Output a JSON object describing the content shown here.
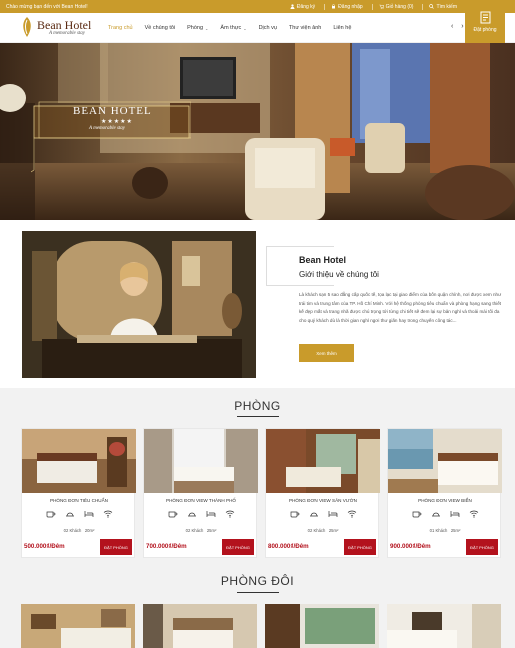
{
  "topbar": {
    "welcome": "Chào mừng bạn đến với Bean Hotel!",
    "register": "Đăng ký",
    "login": "Đăng nhập",
    "cart": "Giỏ hàng (0)",
    "search": "Tìm kiếm"
  },
  "logo": {
    "name": "Bean Hotel",
    "tagline": "A memorable stay"
  },
  "nav": {
    "home": "Trang chủ",
    "about": "Về chúng tôi",
    "rooms": "Phòng",
    "food": "Ẩm thực",
    "services": "Dịch vụ",
    "gallery": "Thư viện ảnh",
    "contact": "Liên hệ",
    "arrows": "‹ ›"
  },
  "book_button": "Đặt phòng",
  "hero": {
    "brand": "BEAN HOTEL",
    "stars": "★★★★★",
    "tagline": "A memorable stay"
  },
  "about": {
    "title": "Bean Hotel",
    "subtitle": "Giới thiệu về chúng tôi",
    "body": "Là khách sạn 5 sao đẳng cấp quốc tế, tọa lạc tại giao điểm của bốn quận chính, nơi được xem như trái tim và trung tâm của TP. Hồ Chí Minh. Với hệ thống phòng tiêu chuẩn và phòng hạng sang thiết kế đẹp mắt và trang nhã được chú trọng tới từng chi tiết sẽ đem lại sự bản nghỉ và thoải mái tối đa cho quý khách dù là thời gian nghỉ ngơi thư giãn hay trong chuyến công tác...",
    "more": "Xem thêm"
  },
  "section_single": "PHÒNG",
  "section_double": "PHÒNG ĐÔI",
  "rooms": [
    {
      "name": "PHÒNG ĐƠN TIÊU CHUẨN",
      "guests": "02 Khách",
      "area": "20m²",
      "price": "500.000₫/Đêm",
      "book": "ĐẶT PHÒNG"
    },
    {
      "name": "PHÒNG ĐƠN VIEW THÀNH PHỐ",
      "guests": "02 Khách",
      "area": "25m²",
      "price": "700.000₫/Đêm",
      "book": "ĐẶT PHÒNG"
    },
    {
      "name": "PHÒNG ĐƠN VIEW SÂN VƯỜN",
      "guests": "02 Khách",
      "area": "25m²",
      "price": "800.000₫/Đêm",
      "book": "ĐẶT PHÒNG"
    },
    {
      "name": "PHÒNG ĐƠN VIEW BIỂN",
      "guests": "01 Khách",
      "area": "25m²",
      "price": "900.000₫/Đêm",
      "book": "ĐẶT PHÒNG"
    }
  ],
  "colors": {
    "brand_gold": "#c99b2b",
    "price_red": "#b3121d",
    "logo_brown": "#5a2a12"
  },
  "icons": [
    "coffee-icon",
    "food-icon",
    "bed-icon",
    "wifi-icon",
    "search-icon",
    "cart-icon",
    "book-icon",
    "star-icon"
  ]
}
